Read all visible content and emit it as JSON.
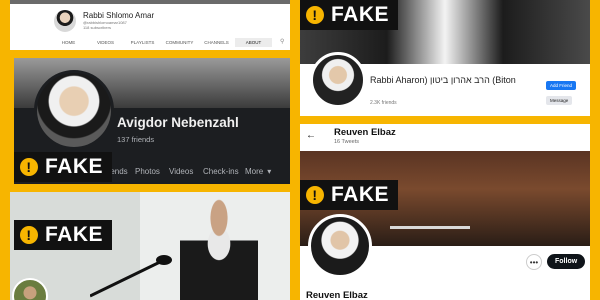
{
  "fake_label": "FAKE",
  "youtube": {
    "channel_name": "Rabbi Shlomo Amar",
    "handle": "@rabbishlomoamar1087",
    "subscribers": "118 subscribers",
    "tabs": [
      "HOME",
      "VIDEOS",
      "PLAYLISTS",
      "COMMUNITY",
      "CHANNELS",
      "ABOUT"
    ],
    "active_tab": "ABOUT"
  },
  "facebook_dark": {
    "name": "Avigdor Nebenzahl",
    "friends": "137 friends",
    "nav": [
      "Friends",
      "Photos",
      "Videos",
      "Check-ins"
    ],
    "more_label": "More"
  },
  "facebook_light": {
    "name": "Rabbi Aharon) הרב אהרון ביטון (Biton",
    "friends": "2.3K friends",
    "add_friend": "Add Friend",
    "message": "Message"
  },
  "twitter": {
    "name": "Reuven Elbaz",
    "tweets": "16 Tweets",
    "follow": "Follow"
  },
  "colors": {
    "background": "#f7b500",
    "badge": "#111111",
    "facebook_blue": "#1877f2"
  }
}
